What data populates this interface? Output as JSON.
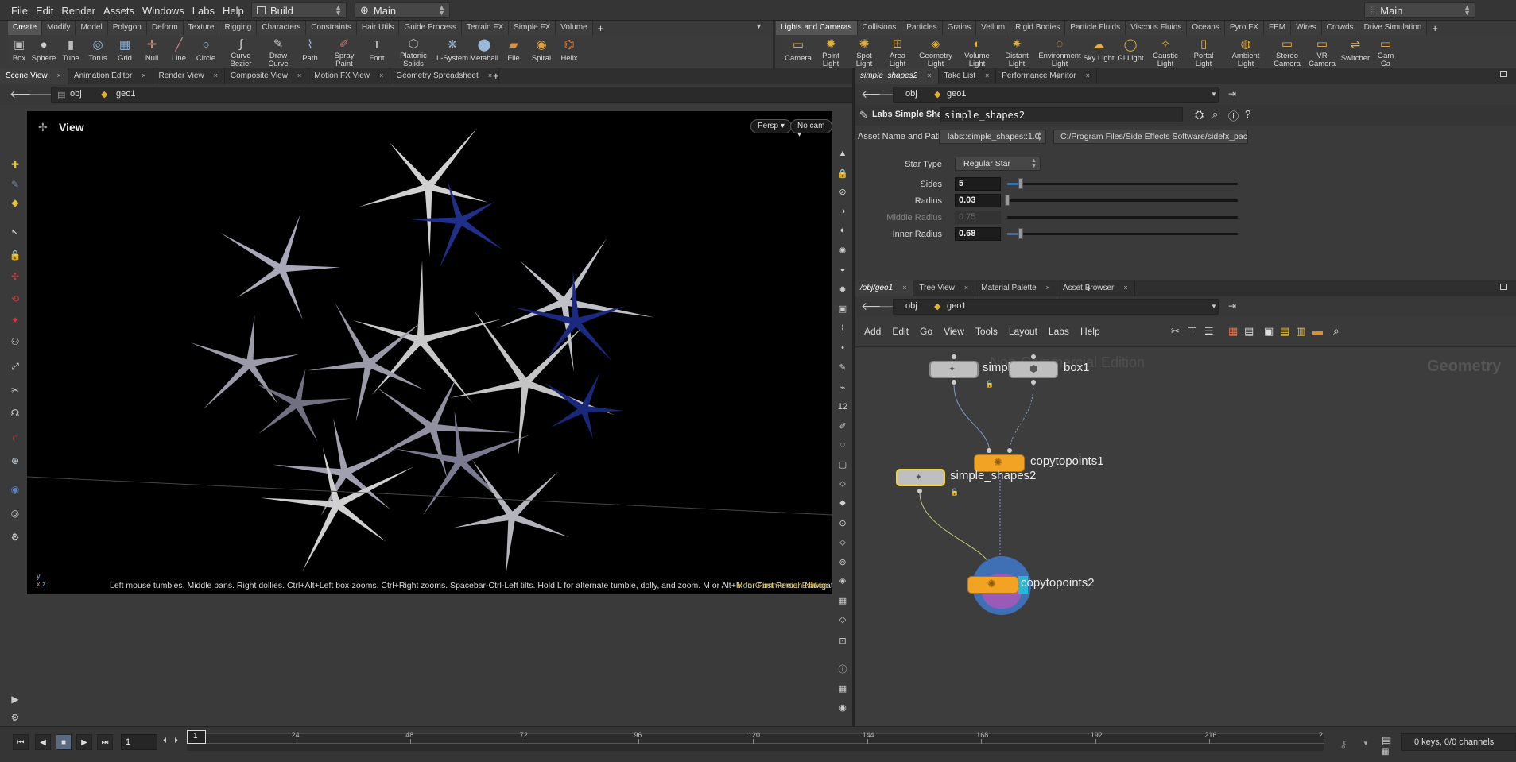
{
  "menubar": {
    "items": [
      "File",
      "Edit",
      "Render",
      "Assets",
      "Windows",
      "Labs",
      "Help"
    ],
    "desktop": "Build",
    "network_context": "Main",
    "right_desktop": "Main"
  },
  "shelf_left": {
    "tabs": [
      "Create",
      "Modify",
      "Model",
      "Polygon",
      "Deform",
      "Texture",
      "Rigging",
      "Characters",
      "Constraints",
      "Hair Utils",
      "Guide Process",
      "Terrain FX",
      "Simple FX",
      "Volume"
    ],
    "selected_tab": "Create",
    "tools": [
      "Box",
      "Sphere",
      "Tube",
      "Torus",
      "Grid",
      "Null",
      "Line",
      "Circle",
      "Curve Bezier",
      "Draw Curve",
      "Path",
      "Spray Paint",
      "Font",
      "Platonic Solids",
      "L-System",
      "Metaball",
      "File",
      "Spiral",
      "Helix"
    ]
  },
  "shelf_right": {
    "tabs": [
      "Lights and Cameras",
      "Collisions",
      "Particles",
      "Grains",
      "Vellum",
      "Rigid Bodies",
      "Particle Fluids",
      "Viscous Fluids",
      "Oceans",
      "Pyro FX",
      "FEM",
      "Wires",
      "Crowds",
      "Drive Simulation"
    ],
    "selected_tab": "Lights and Cameras",
    "tools": [
      "Camera",
      "Point Light",
      "Spot Light",
      "Area Light",
      "Geometry Light",
      "Volume Light",
      "Distant Light",
      "Environment Light",
      "Sky Light",
      "GI Light",
      "Caustic Light",
      "Portal Light",
      "Ambient Light",
      "Stereo Camera",
      "VR Camera",
      "Switcher",
      "Gam Ca"
    ]
  },
  "viewer_pane": {
    "tabs": [
      "Scene View",
      "Animation Editor",
      "Render View",
      "Composite View",
      "Motion FX View",
      "Geometry Spreadsheet"
    ],
    "path_obj": "obj",
    "path_geo": "geo1",
    "view_label": "View",
    "persp": "Persp",
    "camera": "No cam",
    "axis": "y\nx z",
    "status": "Left mouse tumbles. Middle pans. Right dollies. Ctrl+Alt+Left box-zooms. Ctrl+Right zooms. Spacebar-Ctrl-Left tilts. Hold L for alternate tumble, dolly, and zoom. M or Alt+M for First Person Navigation.",
    "edition": "Non-Commercial Edition"
  },
  "params_pane": {
    "tabs": [
      "simple_shapes2",
      "Take List",
      "Performance Monitor"
    ],
    "path_obj": "obj",
    "path_geo": "geo1",
    "node_type": "Labs Simple Shapes",
    "node_name": "simple_shapes2",
    "asset_label": "Asset Name and Path",
    "asset_name": "labs::simple_shapes::1.0",
    "asset_path": "C:/Program Files/Side Effects Software/sidefx_packa...",
    "star_type_label": "Star Type",
    "star_type_value": "Regular Star",
    "params": [
      {
        "label": "Sides",
        "value": "5",
        "fraction": 0.06,
        "enabled": true
      },
      {
        "label": "Radius",
        "value": "0.03",
        "fraction": 0.0,
        "enabled": true
      },
      {
        "label": "Middle Radius",
        "value": "0.75",
        "fraction": 0.06,
        "enabled": false
      },
      {
        "label": "Inner Radius",
        "value": "0.68",
        "fraction": 0.06,
        "enabled": true
      }
    ]
  },
  "network_pane": {
    "tabs": [
      "/obj/geo1",
      "Tree View",
      "Material Palette",
      "Asset Browser"
    ],
    "path_obj": "obj",
    "path_geo": "geo1",
    "menu": [
      "Add",
      "Edit",
      "Go",
      "View",
      "Tools",
      "Layout",
      "Labs",
      "Help"
    ],
    "watermark": "Non-Commercial Edition",
    "context_label": "Geometry",
    "nodes": [
      "simpl",
      "box1",
      "copytopoints1",
      "simple_shapes2",
      "copytopoints2"
    ]
  },
  "timeline": {
    "frame": "1",
    "frame_marker": "1",
    "ticks": [
      "24",
      "48",
      "72",
      "96",
      "120",
      "144",
      "168",
      "192",
      "216",
      "2"
    ],
    "channels": "0 keys, 0/0 channels"
  },
  "colors": {
    "accent": "#e8a21a",
    "selected_outline": "#f2d43a",
    "viewport_bg": "#000000",
    "edition_text": "#d7b72a"
  }
}
